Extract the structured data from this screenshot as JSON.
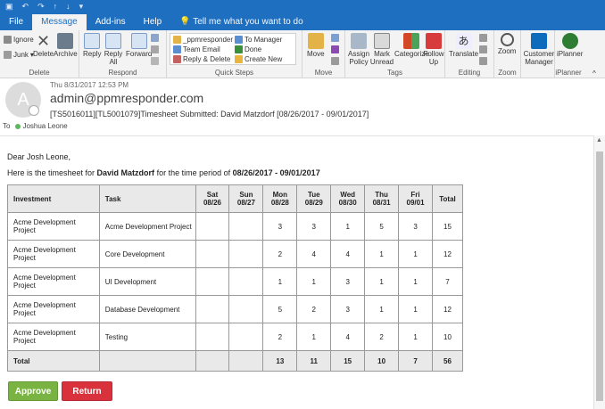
{
  "app": {
    "tabs": [
      "File",
      "Message",
      "Add-ins",
      "Help"
    ],
    "tell_me": "Tell me what you want to do"
  },
  "ribbon": {
    "delete_group": {
      "label": "Delete",
      "ignore": "Ignore",
      "junk": "Junk",
      "delete": "Delete",
      "archive": "Archive"
    },
    "respond_group": {
      "label": "Respond",
      "reply": "Reply",
      "reply_all": "Reply All",
      "forward": "Forward"
    },
    "quick_steps": {
      "label": "Quick Steps",
      "items": [
        "_ppmresponder",
        "To Manager",
        "Team Email",
        "Done",
        "Reply & Delete",
        "Create New"
      ]
    },
    "move_group": {
      "label": "Move",
      "move": "Move"
    },
    "tags_group": {
      "label": "Tags",
      "assign_policy": "Assign Policy",
      "mark_unread": "Mark Unread",
      "categorize": "Categorize",
      "follow_up": "Follow Up"
    },
    "editing_group": {
      "label": "Editing",
      "translate": "Translate"
    },
    "zoom_group": {
      "label": "Zoom",
      "zoom": "Zoom"
    },
    "customer_manager": {
      "label": "Customer Manager"
    },
    "iplanner": {
      "label": "iPlanner",
      "group": "iPlanner"
    }
  },
  "email": {
    "avatar_initial": "A",
    "date": "Thu 8/31/2017 12:53 PM",
    "from": "admin@ppmresponder.com",
    "subject": "[TS5016011][TL5001079]Timesheet Submitted: David Matzdorf [08/26/2017 - 09/01/2017]",
    "to_label": "To",
    "to": "Joshua Leone"
  },
  "body": {
    "greeting": "Dear Josh Leone,",
    "intro_pre": "Here is the timesheet for ",
    "intro_name": "David Matzdorf",
    "intro_mid": " for the time period of ",
    "intro_period": "08/26/2017 - 09/01/2017"
  },
  "table": {
    "headers": [
      {
        "l1": "Investment",
        "l2": ""
      },
      {
        "l1": "Task",
        "l2": ""
      },
      {
        "l1": "Sat",
        "l2": "08/26"
      },
      {
        "l1": "Sun",
        "l2": "08/27"
      },
      {
        "l1": "Mon",
        "l2": "08/28"
      },
      {
        "l1": "Tue",
        "l2": "08/29"
      },
      {
        "l1": "Wed",
        "l2": "08/30"
      },
      {
        "l1": "Thu",
        "l2": "08/31"
      },
      {
        "l1": "Fri",
        "l2": "09/01"
      },
      {
        "l1": "Total",
        "l2": ""
      }
    ],
    "rows": [
      {
        "investment": "Acme Development Project",
        "task": "Acme Development Project",
        "sat": "",
        "sun": "",
        "mon": "3",
        "tue": "3",
        "wed": "1",
        "thu": "5",
        "fri": "3",
        "total": "15"
      },
      {
        "investment": "Acme Development Project",
        "task": "Core Development",
        "sat": "",
        "sun": "",
        "mon": "2",
        "tue": "4",
        "wed": "4",
        "thu": "1",
        "fri": "1",
        "total": "12"
      },
      {
        "investment": "Acme Development Project",
        "task": "UI Development",
        "sat": "",
        "sun": "",
        "mon": "1",
        "tue": "1",
        "wed": "3",
        "thu": "1",
        "fri": "1",
        "total": "7"
      },
      {
        "investment": "Acme Development Project",
        "task": "Database Development",
        "sat": "",
        "sun": "",
        "mon": "5",
        "tue": "2",
        "wed": "3",
        "thu": "1",
        "fri": "1",
        "total": "12"
      },
      {
        "investment": "Acme Development Project",
        "task": "Testing",
        "sat": "",
        "sun": "",
        "mon": "2",
        "tue": "1",
        "wed": "4",
        "thu": "2",
        "fri": "1",
        "total": "10"
      }
    ],
    "total": {
      "label": "Total",
      "mon": "13",
      "tue": "11",
      "wed": "15",
      "thu": "10",
      "fri": "7",
      "total": "56"
    }
  },
  "actions": {
    "approve": "Approve",
    "return": "Return"
  },
  "colors": {
    "title_bar": "#1e6fc0",
    "approve": "#79b342",
    "return": "#d9323d",
    "avatar": "#dcdcdc"
  }
}
